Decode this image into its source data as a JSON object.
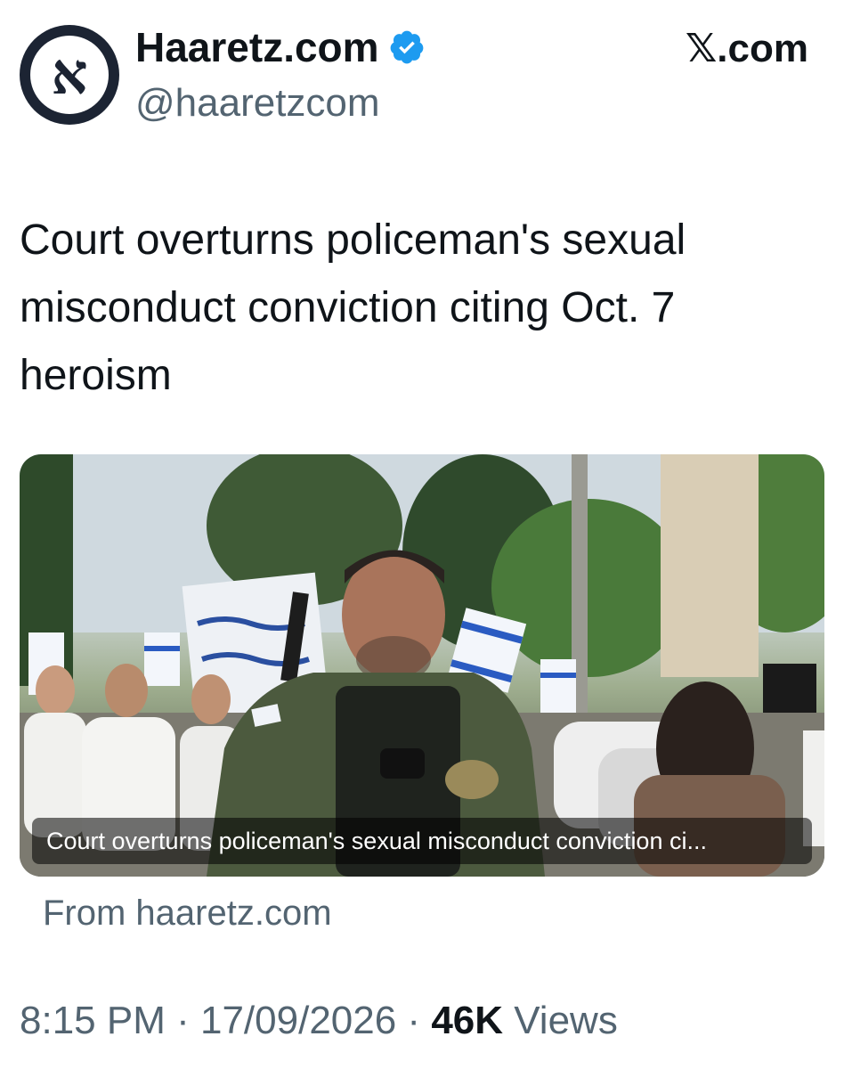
{
  "account": {
    "display_name": "Haaretz.com",
    "handle": "@haaretzcom",
    "avatar_letter": "א",
    "verified": true
  },
  "brand": {
    "label": ".com",
    "mark": "𝕏"
  },
  "tweet": {
    "text": "Court overturns policeman's sexual misconduct conviction citing Oct. 7 heroism"
  },
  "card": {
    "caption": "Court overturns policeman's sexual misconduct conviction ci...",
    "source": "From haaretz.com"
  },
  "meta": {
    "time": "8:15 PM",
    "sep1": " · ",
    "date": "17/09/2026",
    "sep2": " · ",
    "views_count": "46K",
    "views_label": " Views"
  },
  "colors": {
    "verified": "#1d9bf0",
    "text": "#0f1419",
    "muted": "#536471",
    "avatar_bg": "#1c2433"
  }
}
